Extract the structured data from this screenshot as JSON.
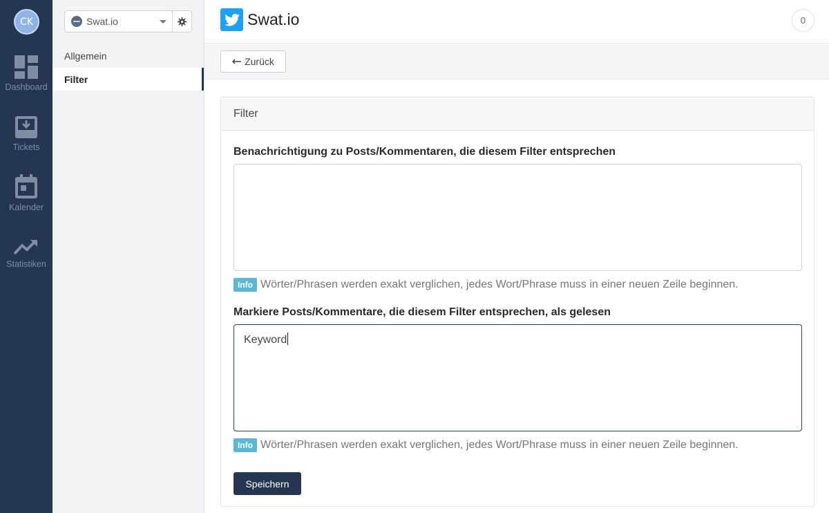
{
  "user": {
    "initials": "CK"
  },
  "rail": {
    "items": [
      {
        "label": "Dashboard",
        "icon": "dashboard-icon"
      },
      {
        "label": "Tickets",
        "icon": "tickets-icon"
      },
      {
        "label": "Kalender",
        "icon": "calendar-icon"
      },
      {
        "label": "Statistiken",
        "icon": "stats-icon"
      }
    ]
  },
  "sidebar": {
    "account": {
      "name": "Swat.io"
    },
    "items": [
      {
        "label": "Allgemein",
        "active": false
      },
      {
        "label": "Filter",
        "active": true
      }
    ]
  },
  "header": {
    "title": "Swat.io",
    "count": "0",
    "network_icon": "twitter-icon"
  },
  "toolbar": {
    "back_label": "Zurück"
  },
  "panel": {
    "title": "Filter",
    "fields": [
      {
        "label": "Benachrichtigung zu Posts/Kommentaren, die diesem Filter entsprechen",
        "value": "",
        "info_tag": "Info",
        "help": "Wörter/Phrasen werden exakt verglichen, jedes Wort/Phrase muss in einer neuen Zeile beginnen."
      },
      {
        "label": "Markiere Posts/Kommentare, die diesem Filter entsprechen, als gelesen",
        "value": "Keyword",
        "info_tag": "Info",
        "help": "Wörter/Phrasen werden exakt verglichen, jedes Wort/Phrase muss in einer neuen Zeile beginnen."
      }
    ],
    "save_label": "Speichern"
  },
  "colors": {
    "rail_bg": "#243650",
    "accent": "#243650",
    "info": "#5bb7d6",
    "twitter": "#1da1f2"
  }
}
